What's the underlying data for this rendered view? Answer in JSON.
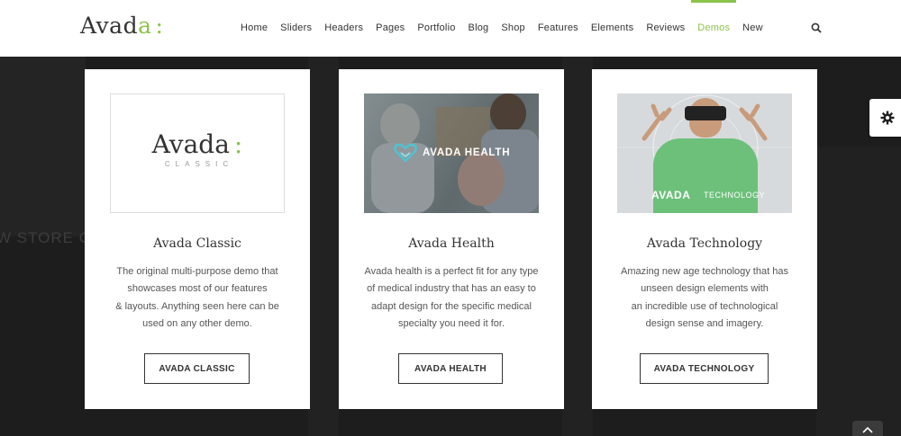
{
  "header": {
    "logo": {
      "main": "Avad",
      "accent": "a",
      "colon": ":"
    },
    "nav": [
      "Home",
      "Sliders",
      "Headers",
      "Pages",
      "Portfolio",
      "Blog",
      "Shop",
      "Features",
      "Elements",
      "Reviews",
      "Demos",
      "New"
    ],
    "active_nav": "Demos"
  },
  "background": {
    "text": "W STORE OPE"
  },
  "cards": [
    {
      "title": "Avada Classic",
      "description": [
        "The original multi-purpose demo that",
        "showcases most of our features",
        "& layouts. Anything seen here can be",
        "used on any other demo."
      ],
      "button": "AVADA CLASSIC",
      "thumb": {
        "logo": "Avada",
        "colon": ":",
        "sub": "CLASSIC"
      }
    },
    {
      "title": "Avada Health",
      "description": [
        "Avada health is a perfect fit for any type",
        "of medical industry that has an easy to",
        "adapt design for the specific medical",
        "specialty you need it for."
      ],
      "button": "AVADA HEALTH",
      "thumb": {
        "logo": "AVADA HEALTH"
      }
    },
    {
      "title": "Avada Technology",
      "description": [
        "Amazing new age technology that has",
        "unseen design elements with",
        "an incredible use of technological",
        "design sense and imagery."
      ],
      "button": "AVADA TECHNOLOGY",
      "thumb": {
        "logo": "AVADA",
        "sub": "TECHNOLOGY"
      }
    }
  ],
  "colors": {
    "accent": "#8bc34a",
    "dark_bg": "#1c1d1c",
    "text": "#333333"
  },
  "icons": {
    "search": "search-icon",
    "gear": "gear-icon",
    "totop": "chevron-up-icon"
  }
}
